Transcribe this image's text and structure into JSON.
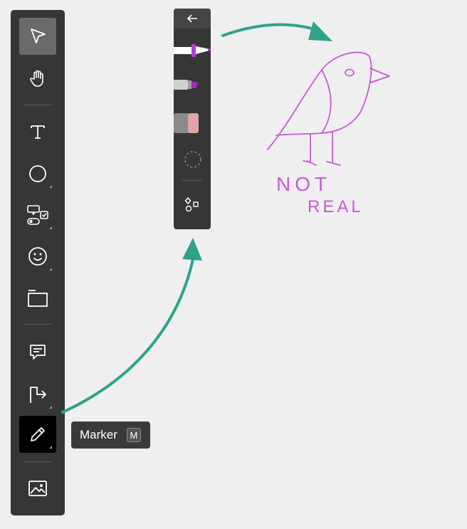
{
  "toolbar": {
    "tools": [
      {
        "name": "move",
        "icon": "pointer-arrow-icon",
        "selected": true
      },
      {
        "name": "hand",
        "icon": "hand-icon"
      },
      {
        "name": "text",
        "icon": "text-icon"
      },
      {
        "name": "shape",
        "icon": "circle-icon"
      },
      {
        "name": "widgets",
        "icon": "widgets-icon"
      },
      {
        "name": "emoji",
        "icon": "smiley-icon"
      },
      {
        "name": "section",
        "icon": "section-frame-icon"
      },
      {
        "name": "comment",
        "icon": "comment-icon"
      },
      {
        "name": "connector",
        "icon": "connector-icon"
      },
      {
        "name": "marker",
        "icon": "marker-pen-icon",
        "active": true
      },
      {
        "name": "image",
        "icon": "image-icon"
      }
    ]
  },
  "tooltip": {
    "label": "Marker",
    "shortcut": "M"
  },
  "marker_panel": {
    "back_icon": "arrow-left-icon",
    "tools": [
      {
        "name": "marker",
        "icon": "marker-pen-icon",
        "color": "#b63dd6",
        "selected": true
      },
      {
        "name": "highlighter",
        "icon": "highlighter-icon",
        "color": "#9b2bb8"
      },
      {
        "name": "eraser",
        "icon": "eraser-icon",
        "color": "#e0a5a8"
      },
      {
        "name": "lasso",
        "icon": "lasso-icon"
      },
      {
        "name": "shapes",
        "icon": "shapes-icon"
      }
    ]
  },
  "canvas": {
    "drawing_text_line1": "NOT",
    "drawing_text_line2": "REAL",
    "drawing_color": "#c85ad6",
    "arrow_color": "#2fa38a"
  }
}
